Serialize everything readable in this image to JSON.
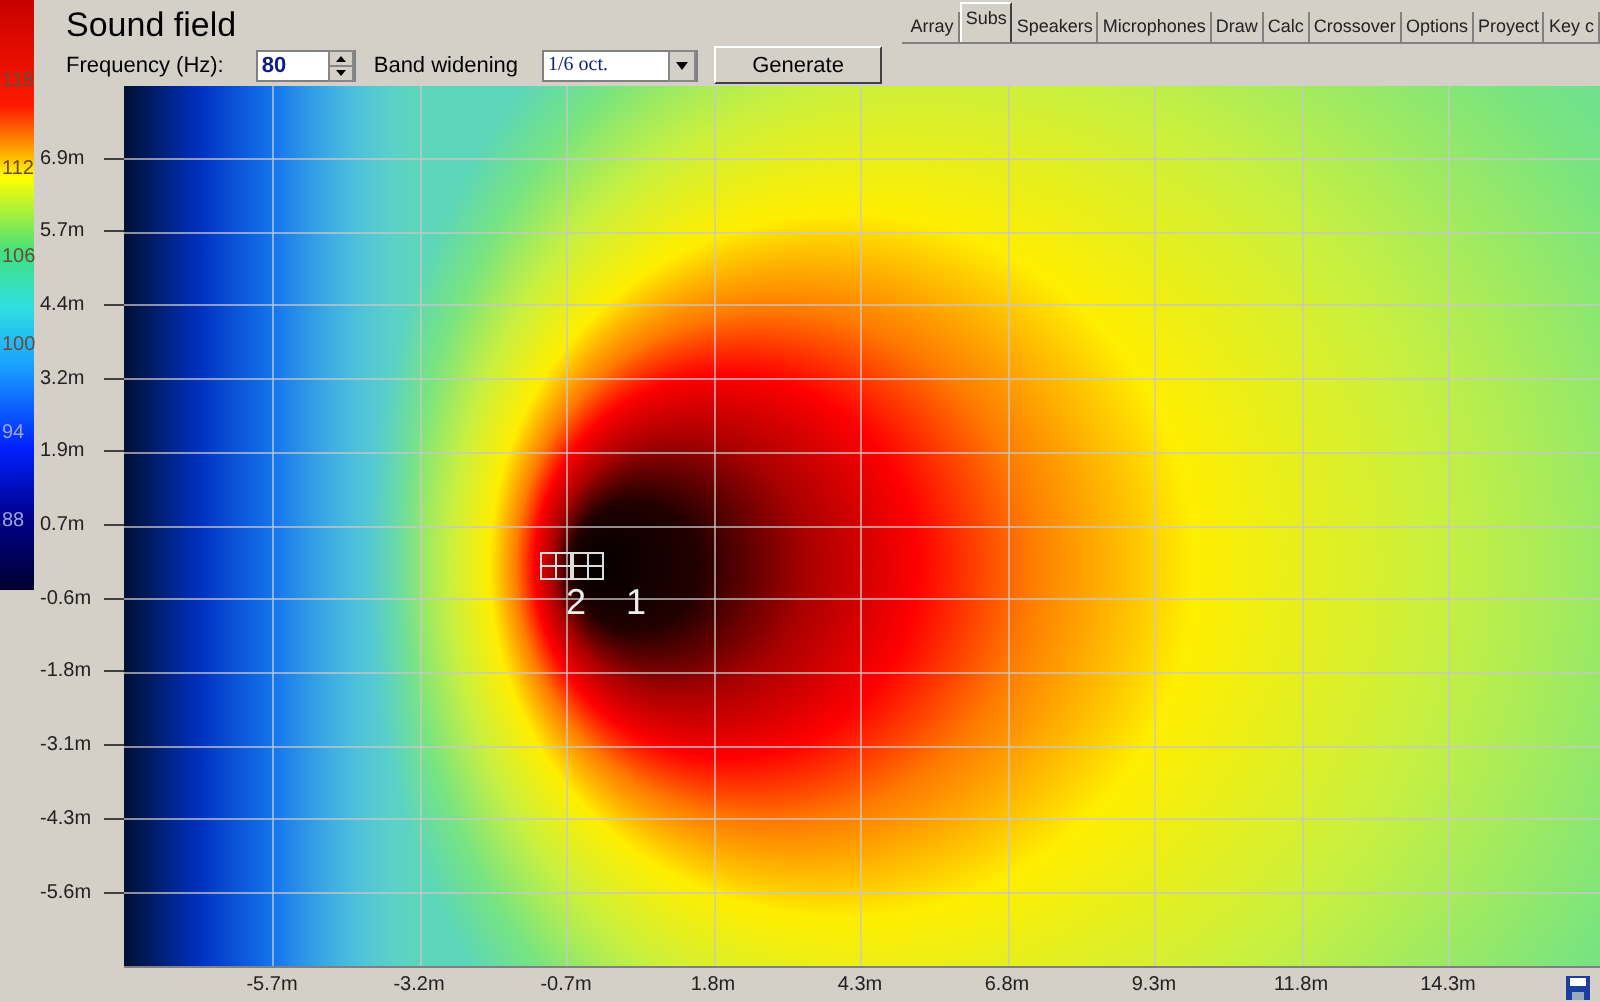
{
  "title": "Sound field",
  "controls": {
    "frequency_label": "Frequency (Hz):",
    "frequency_value": "80",
    "band_label": "Band widening",
    "band_value": "1/6 oct.",
    "generate_button": "Generate"
  },
  "tabs": [
    {
      "label": "Array",
      "selected": false
    },
    {
      "label": "Subs",
      "selected": true
    },
    {
      "label": "Speakers",
      "selected": false
    },
    {
      "label": "Microphones",
      "selected": false
    },
    {
      "label": "Draw",
      "selected": false
    },
    {
      "label": "Calc",
      "selected": false
    },
    {
      "label": "Crossover",
      "selected": false
    },
    {
      "label": "Options",
      "selected": false
    },
    {
      "label": "Proyect",
      "selected": false
    },
    {
      "label": "Key c",
      "selected": false
    }
  ],
  "legend": {
    "labels": [
      "118",
      "112",
      "106",
      "100",
      "94",
      "88"
    ]
  },
  "plot": {
    "y_labels": [
      "6.9m",
      "5.7m",
      "4.4m",
      "3.2m",
      "1.9m",
      "0.7m",
      "-0.6m",
      "-1.8m",
      "-3.1m",
      "-4.3m",
      "-5.6m"
    ],
    "x_labels": [
      "-5.7m",
      "-3.2m",
      "-0.7m",
      "1.8m",
      "4.3m",
      "6.8m",
      "9.3m",
      "11.8m",
      "14.3m"
    ],
    "sources": [
      {
        "label": "2"
      },
      {
        "label": "1"
      }
    ]
  }
}
